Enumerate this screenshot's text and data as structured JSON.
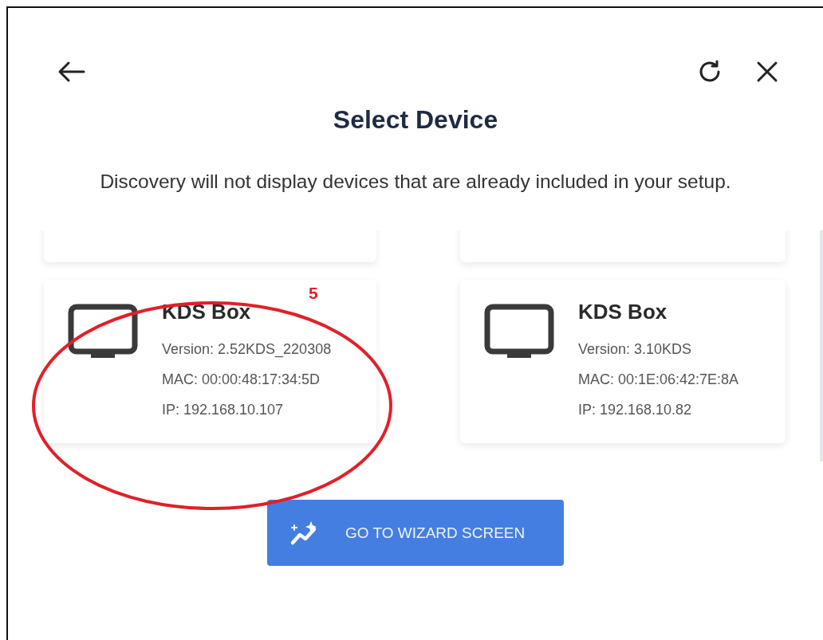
{
  "dialog": {
    "title": "Select Device",
    "description": "Discovery will not display devices that are already included in your setup."
  },
  "devices": [
    {
      "kind": "clipped"
    },
    {
      "kind": "clipped"
    },
    {
      "kind": "full",
      "name": "KDS Box",
      "version": "Version: 2.52KDS_220308",
      "mac": "MAC: 00:00:48:17:34:5D",
      "ip": "IP: 192.168.10.107"
    },
    {
      "kind": "full",
      "name": "KDS Box",
      "version": "Version: 3.10KDS",
      "mac": "MAC: 00:1E:06:42:7E:8A",
      "ip": "IP: 192.168.10.82"
    }
  ],
  "annotation": {
    "number": "5"
  },
  "button": {
    "label": "GO TO WIZARD SCREEN"
  }
}
